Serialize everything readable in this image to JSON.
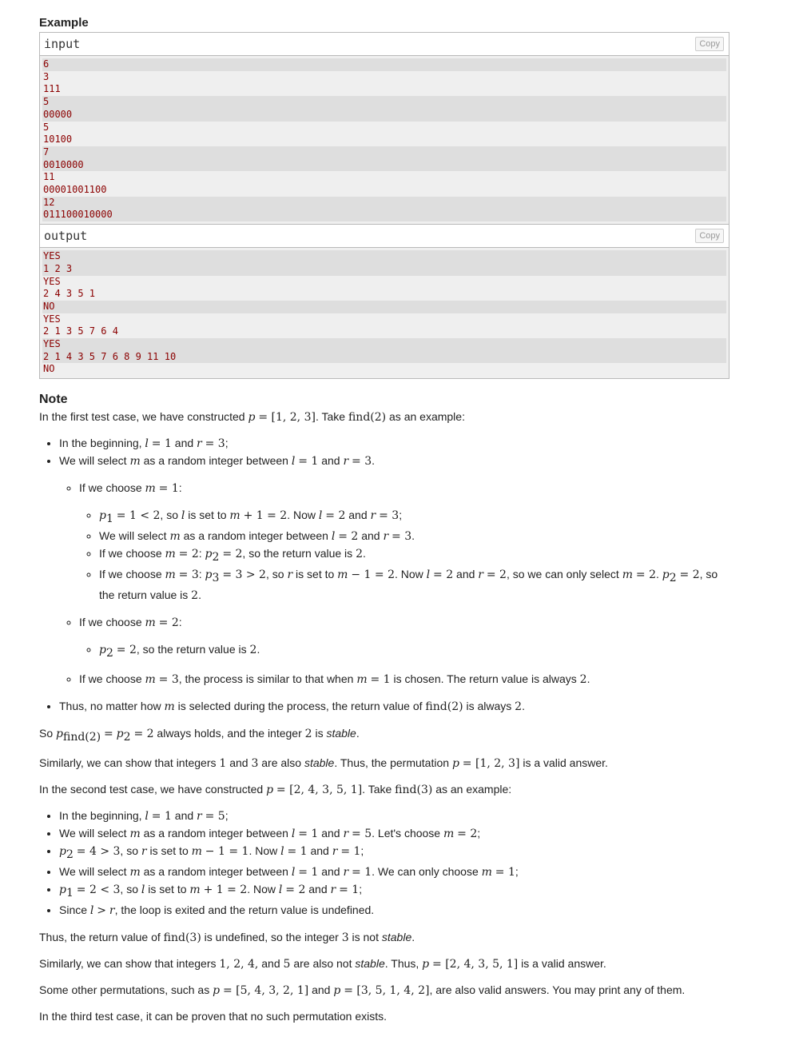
{
  "example": {
    "section_title": "Example",
    "input_label": "input",
    "output_label": "output",
    "copy_label": "Copy",
    "input_groups": [
      [
        "6"
      ],
      [
        "3",
        "111"
      ],
      [
        "5",
        "00000"
      ],
      [
        "5",
        "10100"
      ],
      [
        "7",
        "0010000"
      ],
      [
        "11",
        "00001001100"
      ],
      [
        "12",
        "011100010000"
      ]
    ],
    "output_groups": [
      [
        "YES",
        "1 2 3"
      ],
      [
        "YES",
        "2 4 3 5 1"
      ],
      [
        "NO"
      ],
      [
        "YES",
        "2 1 3 5 7 6 4"
      ],
      [
        "YES",
        "2 1 4 3 5 7 6 8 9 11 10"
      ],
      [
        "NO"
      ]
    ]
  },
  "note": {
    "title": "Note"
  },
  "colors": {
    "code_text": "#8b0000",
    "stripe_dark": "#dedede",
    "stripe_light": "#efefef",
    "border": "#b9b9b9"
  }
}
